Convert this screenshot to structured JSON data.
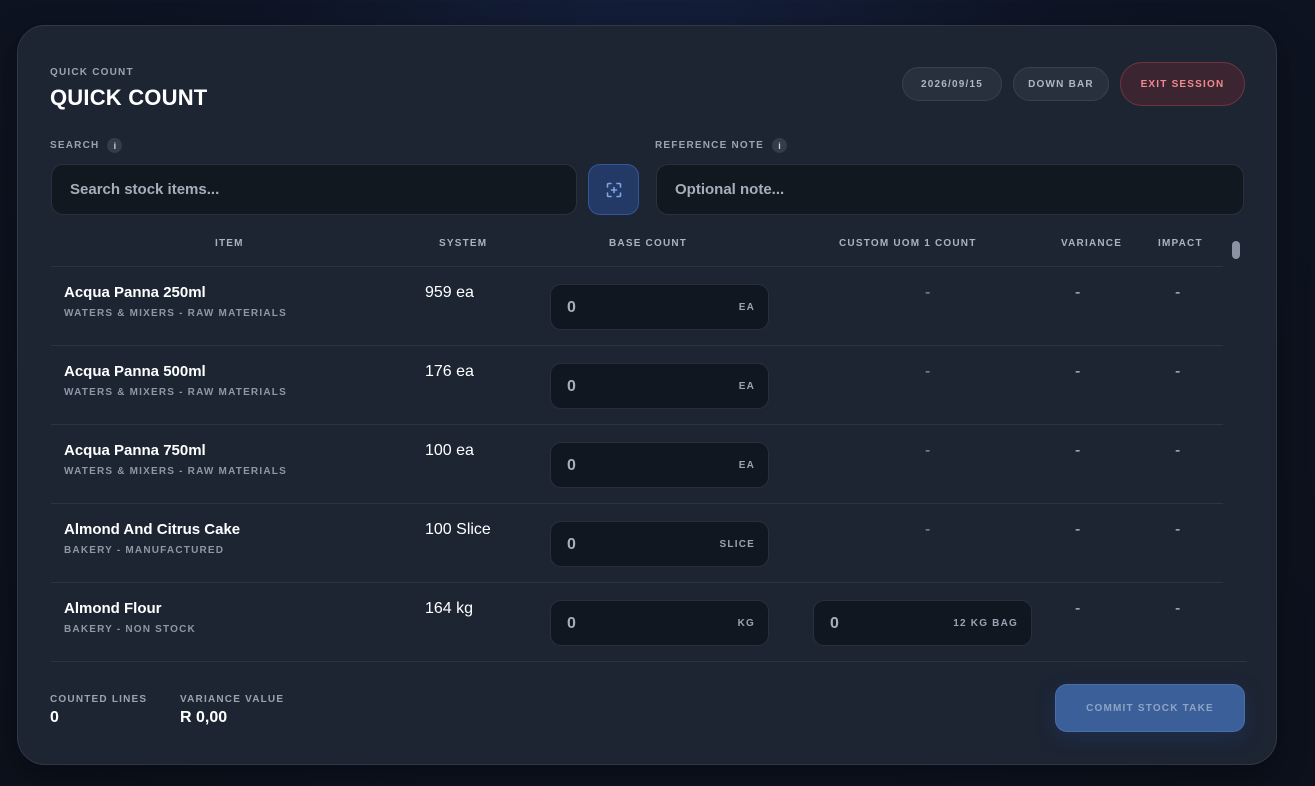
{
  "header": {
    "eyebrow": "QUICK COUNT",
    "title": "QUICK COUNT",
    "date": "2026/09/15",
    "location": "DOWN BAR",
    "exit_label": "EXIT SESSION"
  },
  "search": {
    "label": "SEARCH",
    "placeholder": "Search stock items..."
  },
  "note": {
    "label": "REFERENCE NOTE",
    "placeholder": "Optional note..."
  },
  "table": {
    "columns": [
      "ITEM",
      "SYSTEM",
      "BASE COUNT",
      "CUSTOM UOM 1 COUNT",
      "VARIANCE",
      "IMPACT"
    ],
    "rows": [
      {
        "name": "Acqua Panna 250ml",
        "category": "WATERS & MIXERS - RAW MATERIALS",
        "system": "959 ea",
        "base_value": "0",
        "base_unit": "EA",
        "uom": "-",
        "variance": "-",
        "impact": "-"
      },
      {
        "name": "Acqua Panna 500ml",
        "category": "WATERS & MIXERS - RAW MATERIALS",
        "system": "176 ea",
        "base_value": "0",
        "base_unit": "EA",
        "uom": "-",
        "variance": "-",
        "impact": "-"
      },
      {
        "name": "Acqua Panna 750ml",
        "category": "WATERS & MIXERS - RAW MATERIALS",
        "system": "100 ea",
        "base_value": "0",
        "base_unit": "EA",
        "uom": "-",
        "variance": "-",
        "impact": "-"
      },
      {
        "name": "Almond And Citrus Cake",
        "category": "BAKERY - MANUFACTURED",
        "system": "100 Slice",
        "base_value": "0",
        "base_unit": "SLICE",
        "uom": "-",
        "variance": "-",
        "impact": "-"
      },
      {
        "name": "Almond Flour",
        "category": "BAKERY - NON STOCK",
        "system": "164 kg",
        "base_value": "0",
        "base_unit": "KG",
        "uom_value": "0",
        "uom_unit": "12 KG BAG",
        "variance": "-",
        "impact": "-"
      }
    ]
  },
  "footer": {
    "counted_label": "COUNTED LINES",
    "counted_value": "0",
    "variance_label": "VARIANCE VALUE",
    "variance_value": "R 0,00",
    "commit_label": "COMMIT STOCK TAKE"
  },
  "icons": {
    "info": "info-icon",
    "scan": "scan-icon"
  },
  "colors": {
    "panel": "#1d2533",
    "exit": "#f08a8f",
    "commit": "#3b5f98"
  }
}
